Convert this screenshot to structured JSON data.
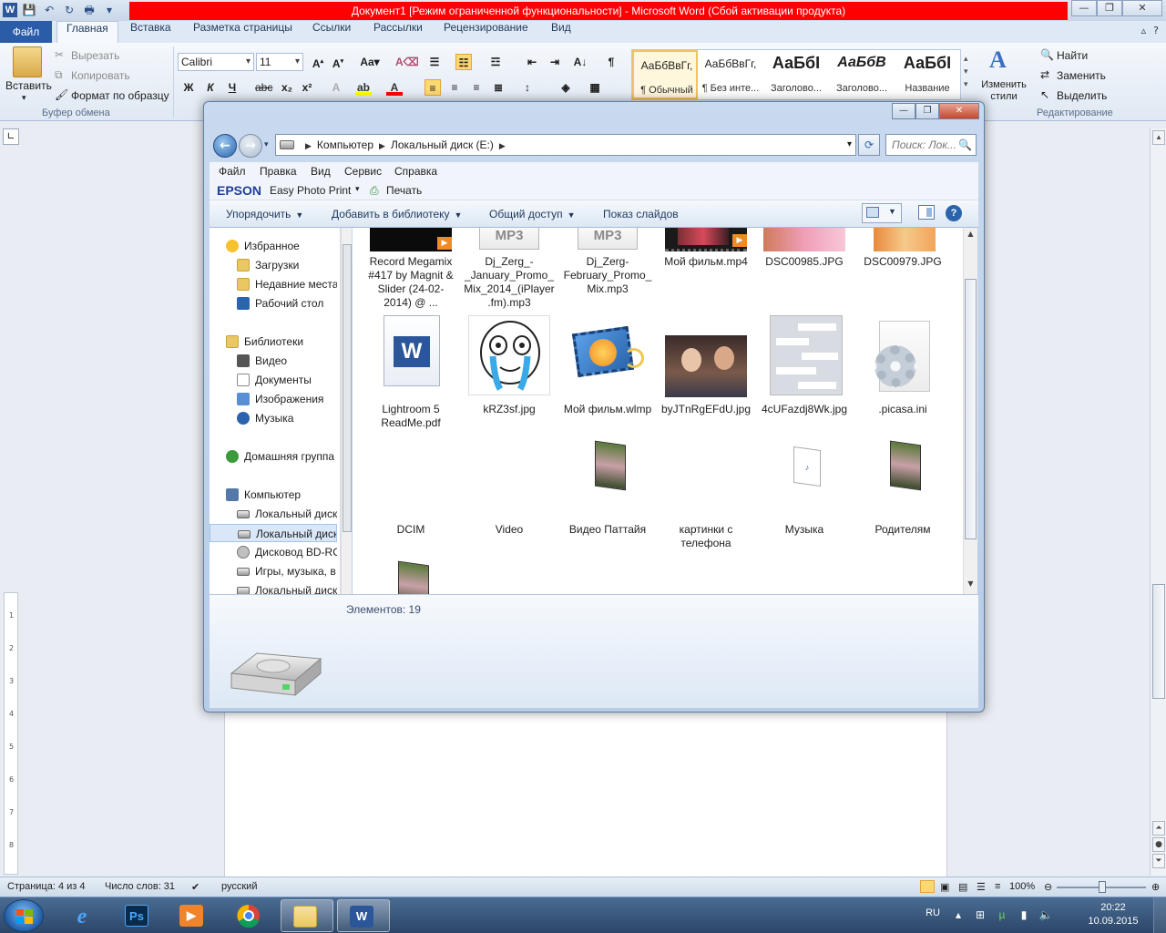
{
  "word": {
    "title": "Документ1 [Режим ограниченной функциональности]  -  Microsoft Word (Сбой активации продукта)",
    "app_icon_letter": "W",
    "tabs": [
      "Главная",
      "Вставка",
      "Разметка страницы",
      "Ссылки",
      "Рассылки",
      "Рецензирование",
      "Вид"
    ],
    "file_tab": "Файл",
    "clipboard": {
      "paste": "Вставить",
      "cut": "Вырезать",
      "copy": "Копировать",
      "format_painter": "Формат по образцу",
      "group": "Буфер обмена"
    },
    "font": {
      "name": "Calibri",
      "size": "11"
    },
    "styles": [
      {
        "sample": "АаБбВвГг,",
        "name": "¶ Обычный"
      },
      {
        "sample": "АаБбВвГг,",
        "name": "¶ Без инте..."
      },
      {
        "sample": "АаБбI",
        "name": "Заголово..."
      },
      {
        "sample": "АаБбВ",
        "name": "Заголово..."
      },
      {
        "sample": "АаБбI",
        "name": "Название"
      }
    ],
    "change_styles": "Изменить стили",
    "editing": {
      "find": "Найти",
      "replace": "Заменить",
      "select": "Выделить",
      "group": "Редактирование"
    },
    "status": {
      "page": "Страница: 4 из 4",
      "words": "Число слов: 31",
      "language": "русский",
      "zoom": "100%"
    }
  },
  "explorer": {
    "address": [
      "Компьютер",
      "Локальный диск (E:)"
    ],
    "search_placeholder": "Поиск: Лок...",
    "menu": [
      "Файл",
      "Правка",
      "Вид",
      "Сервис",
      "Справка"
    ],
    "epson": {
      "brand": "EPSON",
      "photo_print": "Easy Photo Print",
      "print": "Печать"
    },
    "commands": [
      "Упорядочить",
      "Добавить в библиотеку",
      "Общий доступ",
      "Показ слайдов"
    ],
    "nav": [
      {
        "label": "Избранное",
        "type": "star"
      },
      {
        "label": "Загрузки",
        "type": "folder"
      },
      {
        "label": "Недавние места",
        "type": "folder"
      },
      {
        "label": "Рабочий стол",
        "type": "desktop"
      },
      {
        "label": "Библиотеки",
        "type": "library"
      },
      {
        "label": "Видео",
        "type": "video"
      },
      {
        "label": "Документы",
        "type": "doc"
      },
      {
        "label": "Изображения",
        "type": "image"
      },
      {
        "label": "Музыка",
        "type": "music"
      },
      {
        "label": "Домашняя группа",
        "type": "homegroup"
      },
      {
        "label": "Компьютер",
        "type": "computer"
      },
      {
        "label": "Локальный диск",
        "type": "drive"
      },
      {
        "label": "Локальный диск",
        "type": "drive"
      },
      {
        "label": "Дисковод BD-RO",
        "type": "disc"
      },
      {
        "label": "Игры, музыка, в",
        "type": "drive"
      },
      {
        "label": "Локальный диск",
        "type": "drive"
      }
    ],
    "files_row1": [
      {
        "label": "Record Megamix #417 by Magnit & Slider (24-02-2014) @ ...",
        "kind": "video-dark"
      },
      {
        "label": "Dj_Zerg_-_January_Promo_Mix_2014_(iPlayer.fm).mp3",
        "kind": "mp3"
      },
      {
        "label": "Dj_Zerg-February_Promo_Mix.mp3",
        "kind": "mp3"
      },
      {
        "label": "Мой фильм.mp4",
        "kind": "video-film"
      },
      {
        "label": "DSC00985.JPG",
        "kind": "photo-pink"
      },
      {
        "label": "DSC00979.JPG",
        "kind": "photo-orange"
      }
    ],
    "files_row2": [
      {
        "label": "Lightroom 5 ReadMe.pdf",
        "kind": "word-doc"
      },
      {
        "label": "kRZ3sf.jpg",
        "kind": "meme"
      },
      {
        "label": "Мой фильм.wlmp",
        "kind": "moviemaker"
      },
      {
        "label": "byJTnRgEFdU.jpg",
        "kind": "selfie"
      },
      {
        "label": "4cUFazdj8Wk.jpg",
        "kind": "screenshot"
      },
      {
        "label": ".picasa.ini",
        "kind": "settings"
      }
    ],
    "files_row3": [
      {
        "label": "DCIM",
        "kind": "folder"
      },
      {
        "label": "Video",
        "kind": "folder"
      },
      {
        "label": "Видео Паттайя",
        "kind": "folder-photo"
      },
      {
        "label": "картинки с телефона",
        "kind": "folder"
      },
      {
        "label": "Музыка",
        "kind": "folder-mp3"
      },
      {
        "label": "Родителям",
        "kind": "folder-photo"
      }
    ],
    "mp3_badge": "MP3",
    "item_count": "Элементов: 19"
  },
  "taskbar": {
    "apps": [
      "Internet Explorer",
      "Photoshop",
      "Media Player",
      "Chrome",
      "Explorer",
      "Word"
    ],
    "ps_letters": "Ps",
    "lang": "RU",
    "time": "20:22",
    "date": "10.09.2015"
  },
  "colors": {
    "word_blue": "#2a5ca8",
    "title_red": "#ff0000",
    "folder_yellow": "#f3d979",
    "taskbar": "#2b4668"
  }
}
